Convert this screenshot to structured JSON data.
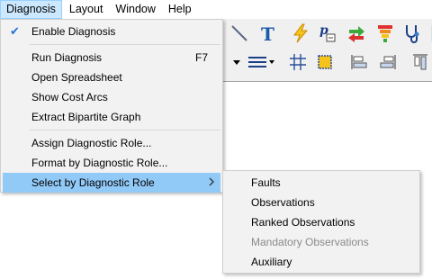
{
  "menubar": {
    "items": [
      {
        "label": "Diagnosis"
      },
      {
        "label": "Layout"
      },
      {
        "label": "Window"
      },
      {
        "label": "Help"
      }
    ]
  },
  "menu": {
    "enable_diagnosis": "Enable Diagnosis",
    "run_diagnosis": "Run Diagnosis",
    "run_diagnosis_shortcut": "F7",
    "open_spreadsheet": "Open Spreadsheet",
    "show_cost_arcs": "Show Cost Arcs",
    "extract_bipartite_graph": "Extract Bipartite Graph",
    "assign_diagnostic_role": "Assign Diagnostic Role...",
    "format_by_diagnostic_role": "Format by Diagnostic Role...",
    "select_by_diagnostic_role": "Select by Diagnostic Role"
  },
  "submenu": {
    "items": [
      {
        "label": "Faults",
        "enabled": true
      },
      {
        "label": "Observations",
        "enabled": true
      },
      {
        "label": "Ranked Observations",
        "enabled": true
      },
      {
        "label": "Mandatory Observations",
        "enabled": false
      },
      {
        "label": "Auxiliary",
        "enabled": true
      }
    ]
  },
  "toolbar": {
    "icons": [
      "arrow-tool-icon",
      "text-tool-icon",
      "lightning-icon",
      "probability-icon",
      "swap-arrows-icon",
      "funnel-icon",
      "stethoscope-icon",
      "line-style-icon",
      "grid-icon",
      "snap-icon",
      "align-left-icon",
      "align-right-icon",
      "align-top-icon"
    ]
  },
  "colors": {
    "highlight": "#91c9f7",
    "menubar_active": "#cce8ff",
    "menu_bg": "#f2f2f2"
  }
}
